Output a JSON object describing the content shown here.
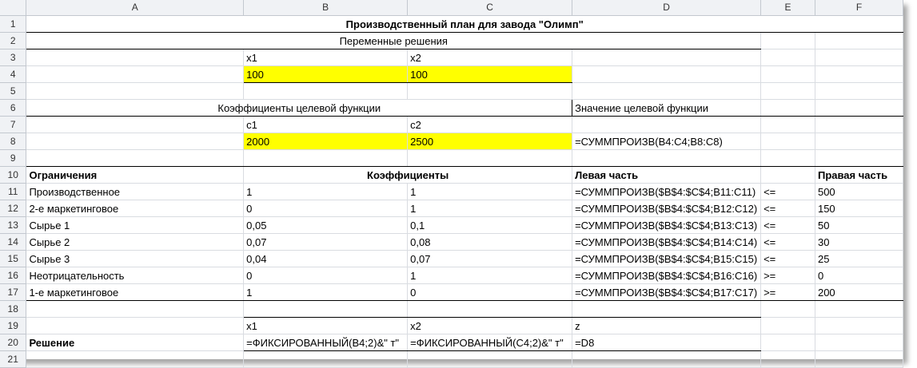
{
  "columns": [
    "A",
    "B",
    "C",
    "D",
    "E",
    "F"
  ],
  "rows": [
    "1",
    "2",
    "3",
    "4",
    "5",
    "6",
    "7",
    "8",
    "9",
    "10",
    "11",
    "12",
    "13",
    "14",
    "15",
    "16",
    "17",
    "18",
    "19",
    "20",
    "21"
  ],
  "cells": {
    "title": "Производственный план для завода \"Олимп\"",
    "vars_header": "Переменные решения",
    "x1": "x1",
    "x2": "x2",
    "x1_val": "100",
    "x2_val": "100",
    "coef_header": "Коэффициенты целевой функции",
    "obj_header": "Значение целевой функции",
    "c1": "c1",
    "c2": "c2",
    "c1_val": "2000",
    "c2_val": "2500",
    "obj_formula": "=СУММПРОИЗВ(B4:C4;B8:C8)",
    "constraints_label": "Ограничения",
    "coefficients_label": "Коэффициенты",
    "left_label": "Левая часть",
    "right_label": "Правая часть",
    "solution_x1": "x1",
    "solution_x2": "x2",
    "solution_z": "z",
    "solution_label": "Решение",
    "solution_x1_formula": "=ФИКСИРОВАННЫЙ(B4;2)&\" т\"",
    "solution_x2_formula": "=ФИКСИРОВАННЫЙ(C4;2)&\" т\"",
    "solution_z_formula": "=D8"
  },
  "constraints": [
    {
      "name": "Производственное",
      "b": "1",
      "c": "1",
      "formula": "=СУММПРОИЗВ($B$4:$C$4;B11:C11)",
      "sign": "<=",
      "rhs": "500"
    },
    {
      "name": "2-е маркетинговое",
      "b": "0",
      "c": "1",
      "formula": "=СУММПРОИЗВ($B$4:$C$4;B12:C12)",
      "sign": "<=",
      "rhs": "150"
    },
    {
      "name": "Сырье 1",
      "b": "0,05",
      "c": "0,1",
      "formula": "=СУММПРОИЗВ($B$4:$C$4;B13:C13)",
      "sign": "<=",
      "rhs": "50"
    },
    {
      "name": "Сырье 2",
      "b": "0,07",
      "c": "0,08",
      "formula": "=СУММПРОИЗВ($B$4:$C$4;B14:C14)",
      "sign": "<=",
      "rhs": "30"
    },
    {
      "name": "Сырье 3",
      "b": "0,04",
      "c": "0,07",
      "formula": "=СУММПРОИЗВ($B$4:$C$4;B15:C15)",
      "sign": "<=",
      "rhs": "25"
    },
    {
      "name": "Неотрицательность",
      "b": "0",
      "c": "1",
      "formula": "=СУММПРОИЗВ($B$4:$C$4;B16:C16)",
      "sign": ">=",
      "rhs": "0"
    },
    {
      "name": "1-е маркетинговое",
      "b": "1",
      "c": "0",
      "formula": "=СУММПРОИЗВ($B$4:$C$4;B17:C17)",
      "sign": ">=",
      "rhs": "200"
    }
  ],
  "colors": {
    "highlight": "#ffff00",
    "header_bg": "#f0f2f5",
    "grid": "#d9dce1"
  }
}
